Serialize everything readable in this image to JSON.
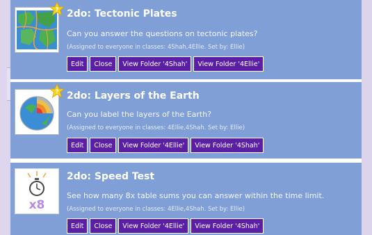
{
  "assignments": [
    {
      "title": "2do: Tectonic Plates",
      "description": "Can you answer the questions on tectonic plates?",
      "assigned": "(Assigned to everyone in classes: 4Shah,4Ellie. Set by: Ellie)",
      "buttons": [
        "Edit",
        "Close",
        "View Folder '4Shah'",
        "View Folder '4Ellie'"
      ],
      "icon": "tectonic-map-icon",
      "starred": true
    },
    {
      "title": "2do: Layers of the Earth",
      "description": "Can you label the layers of the Earth?",
      "assigned": "(Assigned to everyone in classes: 4Ellie,4Shah. Set by: Ellie)",
      "buttons": [
        "Edit",
        "Close",
        "View Folder '4Ellie'",
        "View Folder '4Shah'"
      ],
      "icon": "earth-layers-icon",
      "starred": true
    },
    {
      "title": "2do: Speed Test",
      "description": "See how many 8x table sums you can answer within the time limit.",
      "assigned": "(Assigned to everyone in classes: 4Ellie,4Shah. Set by: Ellie)",
      "buttons": [
        "Edit",
        "Close",
        "View Folder '4Ellie'",
        "View Folder '4Shah'"
      ],
      "icon": "stopwatch-x8-icon",
      "starred": false
    }
  ],
  "star_badge": "?",
  "thumb_text": "x8",
  "colors": {
    "card": "#7f9fd6",
    "button": "#5a1fa5",
    "background": "#dcd3ec"
  }
}
